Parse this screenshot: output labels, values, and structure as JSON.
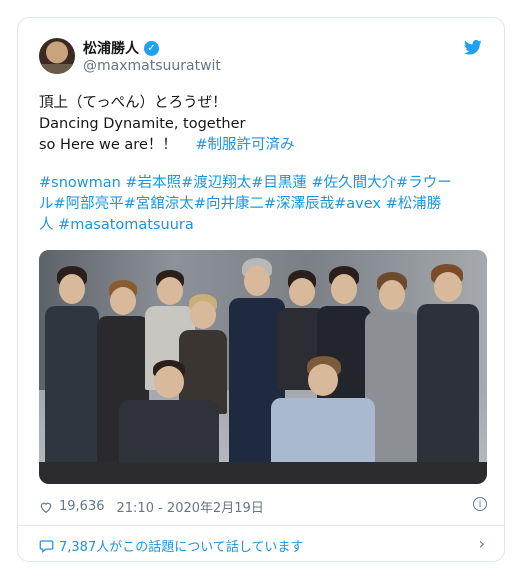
{
  "author": {
    "display_name": "松浦勝人",
    "handle": "@maxmatsuuratwit",
    "verified_glyph": "✓"
  },
  "tweet": {
    "lines": [
      {
        "text": "頂上（てっぺん）とろうぜ！"
      },
      {
        "text": "Dancing Dynamite, together"
      },
      {
        "text": "so Here we are！！",
        "tag": "#制服許可済み"
      }
    ],
    "hashtag_lines": [
      "#snowman #岩本照#渡辺翔太#目黒蓮 #佐久間大介#ラウー",
      "ル#阿部亮平#宮舘涼太#向井康二#深澤辰哉#avex #松浦勝",
      "人 #masatomatsuura"
    ]
  },
  "meta": {
    "likes": "19,636",
    "timestamp": "21:10 - 2020年2月19日",
    "info_glyph": "i"
  },
  "conversation": {
    "text": "7,387人がこの話題について話しています",
    "chevron": "›"
  },
  "icons": [
    "verified-badge-icon",
    "twitter-bird-icon",
    "heart-icon",
    "info-icon",
    "speech-bubble-icon",
    "chevron-right-icon"
  ],
  "colors": {
    "link": "#1b95e0",
    "muted": "#657786",
    "verified": "#1da1f2"
  }
}
